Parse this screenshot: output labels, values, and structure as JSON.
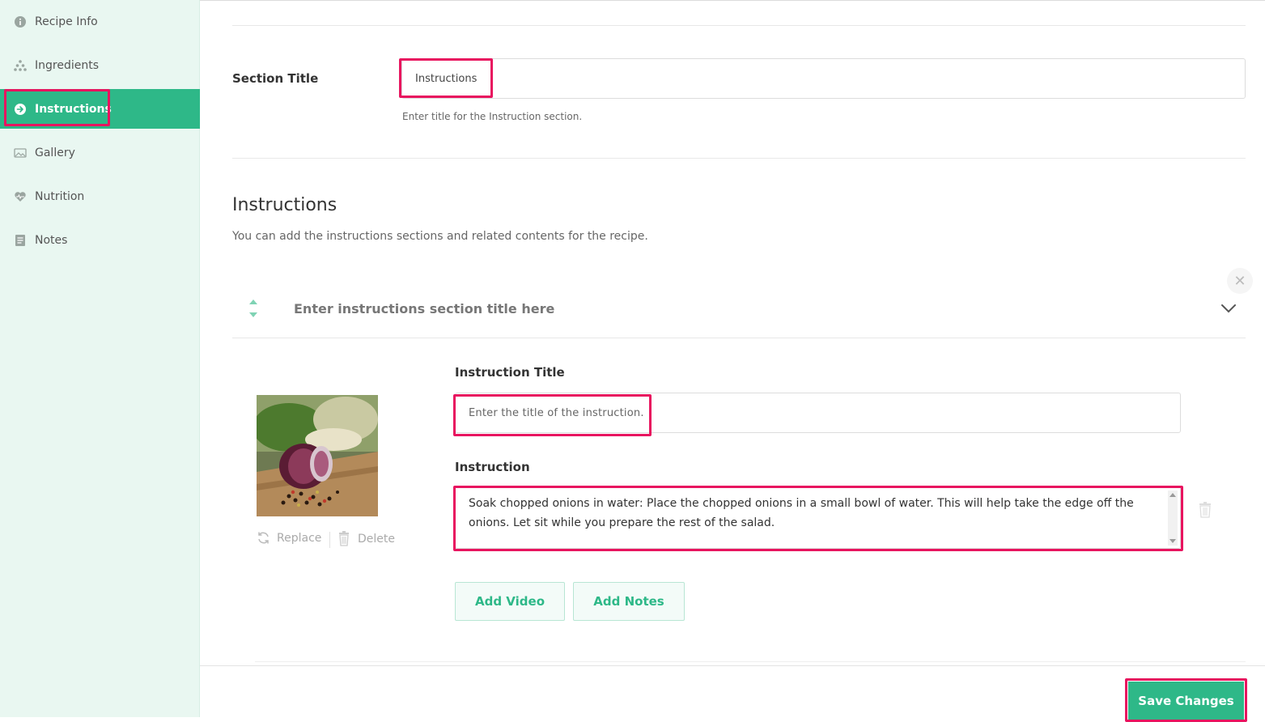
{
  "sidebar": {
    "items": [
      {
        "label": "Recipe Info",
        "icon": "info-icon"
      },
      {
        "label": "Ingredients",
        "icon": "ingredients-icon"
      },
      {
        "label": "Instructions",
        "icon": "arrow-right-circle-icon",
        "active": true
      },
      {
        "label": "Gallery",
        "icon": "gallery-icon"
      },
      {
        "label": "Nutrition",
        "icon": "heartbeat-icon"
      },
      {
        "label": "Notes",
        "icon": "notes-icon"
      }
    ]
  },
  "section_title": {
    "label": "Section Title",
    "value": "Instructions",
    "help": "Enter title for the Instruction section."
  },
  "instructions": {
    "heading": "Instructions",
    "description": "You can add the instructions sections and related contents for the recipe.",
    "section_placeholder": "Enter instructions section title here",
    "image_actions": {
      "replace": "Replace",
      "delete": "Delete"
    },
    "instruction_title_label": "Instruction Title",
    "instruction_title_placeholder": "Enter the title of the instruction.",
    "instruction_label": "Instruction",
    "instruction_text": "Soak chopped onions in water: Place the chopped onions in a small bowl of water. This will help take the edge off the onions. Let sit while you prepare the rest of the salad.",
    "add_video": "Add Video",
    "add_notes": "Add Notes"
  },
  "footer": {
    "save_label": "Save Changes"
  },
  "colors": {
    "accent": "#2eb888",
    "highlight": "#e8145f",
    "sidebar_bg": "#e9f7f1"
  }
}
